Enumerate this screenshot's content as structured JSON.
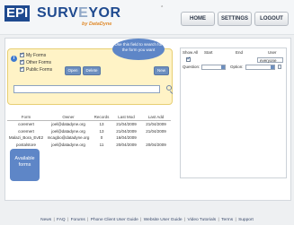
{
  "header": {
    "logo_prefix": "EPI",
    "logo_main_a": "SURV",
    "logo_main_b": "E",
    "logo_main_c": "YOR",
    "logo_tagline": "by DataDyne",
    "badge": "a",
    "nav": [
      "HOME",
      "SETTINGS",
      "LOGOUT"
    ]
  },
  "search_panel": {
    "checkboxes": [
      {
        "label": "My Forms",
        "checked": true
      },
      {
        "label": "Other Forms",
        "checked": true
      },
      {
        "label": "Public Forms",
        "checked": true
      }
    ],
    "buttons": [
      "Open",
      "Delete",
      "New"
    ],
    "tooltip": "Use this field to search for the form you want",
    "search_value": ""
  },
  "forms_table": {
    "columns": [
      "Form",
      "Owner",
      "Records",
      "Last Mod",
      "Last Add"
    ],
    "rows": [
      [
        "coremert",
        "joel@datadyne.org",
        "13",
        "21/04/2009",
        "21/04/2009"
      ],
      [
        "coremert",
        "joel@datadyne.org",
        "13",
        "21/04/2009",
        "21/04/2009"
      ],
      [
        "Malazi_Bora_EvE2",
        "mcagbo@datadyne.org",
        "0",
        "16/04/2009",
        ""
      ],
      [
        "postalstore",
        "joel@datadyne.org",
        "11",
        "20/04/2009",
        "20/04/2009"
      ]
    ]
  },
  "tooltip_forms": "Available forms",
  "right_panel": {
    "headers": [
      "Show All",
      "Start",
      "End",
      "User"
    ],
    "user_value": "everyone",
    "question_label": "Question:",
    "option_label": "Option:"
  },
  "footer": {
    "links": [
      "News",
      "FAQ",
      "Forums",
      "Phone Client User Guide",
      "Website User Guide",
      "Video Tutorials",
      "Terms",
      "Support"
    ]
  },
  "colors": {
    "brand_blue": "#1f4a8f",
    "accent_orange": "#e08a2a",
    "panel_yellow": "#fff3c6",
    "tooltip_blue": "#5e86c7"
  }
}
